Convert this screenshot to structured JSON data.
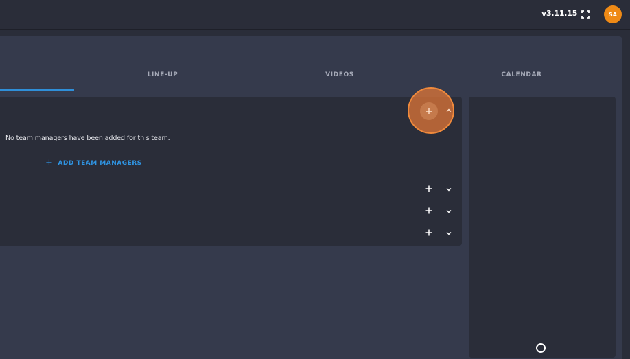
{
  "header": {
    "version": "v3.11.15",
    "fullscreen_icon": "fullscreen-icon",
    "avatar_initials": "SA",
    "avatar_color": "#ef8a16"
  },
  "tabs": [
    {
      "label": ""
    },
    {
      "label": "LINE-UP"
    },
    {
      "label": "VIDEOS"
    },
    {
      "label": "CALENDAR"
    }
  ],
  "active_tab_color": "#2f8fd9",
  "team_managers": {
    "empty_message": "No team managers have been added for this team.",
    "add_label": "ADD TEAM MANAGERS",
    "add_icon": "plus-icon"
  },
  "sections": [
    {
      "add_icon": "plus-icon",
      "toggle_icon": "chevron-up-icon",
      "expanded": true
    },
    {
      "add_icon": "plus-icon",
      "toggle_icon": "chevron-down-icon",
      "expanded": false
    },
    {
      "add_icon": "plus-icon",
      "toggle_icon": "chevron-down-icon",
      "expanded": false
    },
    {
      "add_icon": "plus-icon",
      "toggle_icon": "chevron-down-icon",
      "expanded": false
    }
  ],
  "highlight_color": "#f08a3c",
  "link_color": "#2f95e4"
}
